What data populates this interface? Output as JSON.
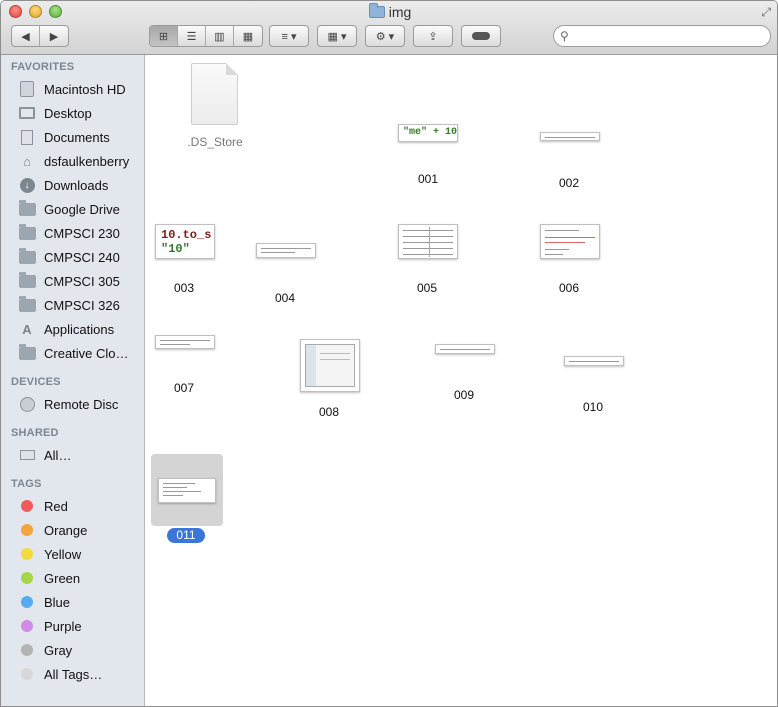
{
  "window": {
    "title": "img"
  },
  "sidebar": {
    "favorites_header": "FAVORITES",
    "favorites": [
      {
        "label": "Macintosh HD",
        "icon": "hard-drive-icon"
      },
      {
        "label": "Desktop",
        "icon": "desktop-icon"
      },
      {
        "label": "Documents",
        "icon": "documents-icon"
      },
      {
        "label": "dsfaulkenberry",
        "icon": "home-icon"
      },
      {
        "label": "Downloads",
        "icon": "downloads-icon"
      },
      {
        "label": "Google Drive",
        "icon": "folder-icon"
      },
      {
        "label": "CMPSCI 230",
        "icon": "folder-icon"
      },
      {
        "label": "CMPSCI 240",
        "icon": "folder-icon"
      },
      {
        "label": "CMPSCI 305",
        "icon": "folder-icon"
      },
      {
        "label": "CMPSCI 326",
        "icon": "folder-icon"
      },
      {
        "label": "Applications",
        "icon": "applications-icon"
      },
      {
        "label": "Creative Clo…",
        "icon": "folder-icon"
      }
    ],
    "devices_header": "DEVICES",
    "devices": [
      {
        "label": "Remote Disc",
        "icon": "disc-icon"
      }
    ],
    "shared_header": "SHARED",
    "shared": [
      {
        "label": "All…",
        "icon": "network-icon"
      }
    ],
    "tags_header": "TAGS",
    "tags": [
      {
        "label": "Red",
        "color": "#f25b5b"
      },
      {
        "label": "Orange",
        "color": "#f6a33b"
      },
      {
        "label": "Yellow",
        "color": "#f2dc3c"
      },
      {
        "label": "Green",
        "color": "#a5d64a"
      },
      {
        "label": "Blue",
        "color": "#5aaaf2"
      },
      {
        "label": "Purple",
        "color": "#d28ae6"
      },
      {
        "label": "Gray",
        "color": "#b3b3b3"
      },
      {
        "label": "All Tags…",
        "color": "#d8d8d8"
      }
    ]
  },
  "files": [
    {
      "name": ".DS_Store"
    },
    {
      "name": "001",
      "preview": "\"me\" + 10"
    },
    {
      "name": "002"
    },
    {
      "name": "003",
      "preview_line1": "10.to_s",
      "preview_line2": "\"10\""
    },
    {
      "name": "004"
    },
    {
      "name": "005"
    },
    {
      "name": "006"
    },
    {
      "name": "007"
    },
    {
      "name": "008"
    },
    {
      "name": "009"
    },
    {
      "name": "010"
    },
    {
      "name": "011",
      "selected": true
    }
  ],
  "search": {
    "placeholder": ""
  }
}
